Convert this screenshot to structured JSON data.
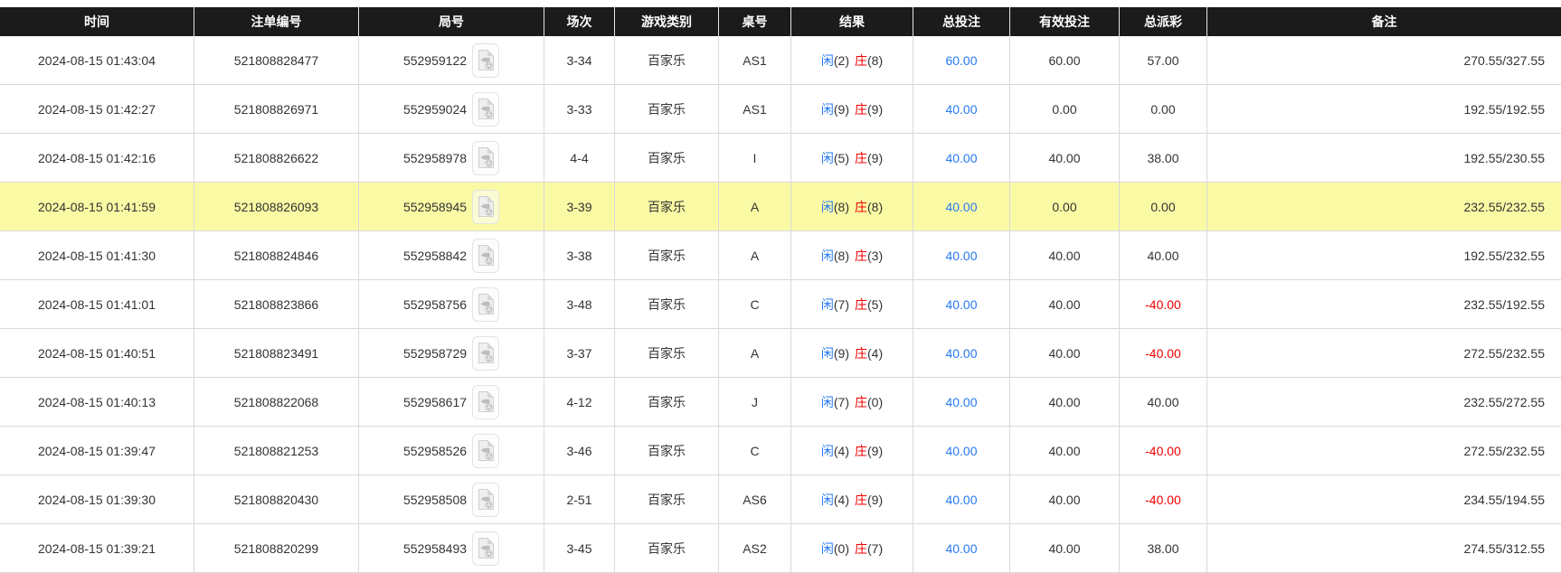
{
  "colors": {
    "header_bg": "#1b1b1b",
    "header_text": "#ffffff",
    "row_border": "#d9d9d9",
    "highlight_bg": "#fafaa5",
    "link_blue": "#2779f2",
    "loss_red": "#f20000",
    "text": "#333333"
  },
  "icons": {
    "video_replay": "video-file-icon"
  },
  "table": {
    "columns": [
      {
        "key": "time",
        "label": "时间"
      },
      {
        "key": "bet_no",
        "label": "注单编号"
      },
      {
        "key": "round_no",
        "label": "局号"
      },
      {
        "key": "session",
        "label": "场次"
      },
      {
        "key": "game_type",
        "label": "游戏类别"
      },
      {
        "key": "table_no",
        "label": "桌号"
      },
      {
        "key": "result",
        "label": "结果"
      },
      {
        "key": "total_bet",
        "label": "总投注"
      },
      {
        "key": "valid_bet",
        "label": "有效投注"
      },
      {
        "key": "total_payout",
        "label": "总派彩"
      },
      {
        "key": "remark",
        "label": "备注"
      }
    ],
    "result_labels": {
      "player": "闲",
      "banker": "庄"
    },
    "rows": [
      {
        "time": "2024-08-15 01:43:04",
        "bet_no": "521808828477",
        "round_no": "552959122",
        "session": "3-34",
        "game_type": "百家乐",
        "table_no": "AS1",
        "result": {
          "player": "(2)",
          "banker": "(8)"
        },
        "total_bet": "60.00",
        "valid_bet": "60.00",
        "total_payout": "57.00",
        "remark": "270.55/327.55",
        "highlighted": false
      },
      {
        "time": "2024-08-15 01:42:27",
        "bet_no": "521808826971",
        "round_no": "552959024",
        "session": "3-33",
        "game_type": "百家乐",
        "table_no": "AS1",
        "result": {
          "player": "(9)",
          "banker": "(9)"
        },
        "total_bet": "40.00",
        "valid_bet": "0.00",
        "total_payout": "0.00",
        "remark": "192.55/192.55",
        "highlighted": false
      },
      {
        "time": "2024-08-15 01:42:16",
        "bet_no": "521808826622",
        "round_no": "552958978",
        "session": "4-4",
        "game_type": "百家乐",
        "table_no": "I",
        "result": {
          "player": "(5)",
          "banker": "(9)"
        },
        "total_bet": "40.00",
        "valid_bet": "40.00",
        "total_payout": "38.00",
        "remark": "192.55/230.55",
        "highlighted": false
      },
      {
        "time": "2024-08-15 01:41:59",
        "bet_no": "521808826093",
        "round_no": "552958945",
        "session": "3-39",
        "game_type": "百家乐",
        "table_no": "A",
        "result": {
          "player": "(8)",
          "banker": "(8)"
        },
        "total_bet": "40.00",
        "valid_bet": "0.00",
        "total_payout": "0.00",
        "remark": "232.55/232.55",
        "highlighted": true
      },
      {
        "time": "2024-08-15 01:41:30",
        "bet_no": "521808824846",
        "round_no": "552958842",
        "session": "3-38",
        "game_type": "百家乐",
        "table_no": "A",
        "result": {
          "player": "(8)",
          "banker": "(3)"
        },
        "total_bet": "40.00",
        "valid_bet": "40.00",
        "total_payout": "40.00",
        "remark": "192.55/232.55",
        "highlighted": false
      },
      {
        "time": "2024-08-15 01:41:01",
        "bet_no": "521808823866",
        "round_no": "552958756",
        "session": "3-48",
        "game_type": "百家乐",
        "table_no": "C",
        "result": {
          "player": "(7)",
          "banker": "(5)"
        },
        "total_bet": "40.00",
        "valid_bet": "40.00",
        "total_payout": "-40.00",
        "remark": "232.55/192.55",
        "highlighted": false
      },
      {
        "time": "2024-08-15 01:40:51",
        "bet_no": "521808823491",
        "round_no": "552958729",
        "session": "3-37",
        "game_type": "百家乐",
        "table_no": "A",
        "result": {
          "player": "(9)",
          "banker": "(4)"
        },
        "total_bet": "40.00",
        "valid_bet": "40.00",
        "total_payout": "-40.00",
        "remark": "272.55/232.55",
        "highlighted": false
      },
      {
        "time": "2024-08-15 01:40:13",
        "bet_no": "521808822068",
        "round_no": "552958617",
        "session": "4-12",
        "game_type": "百家乐",
        "table_no": "J",
        "result": {
          "player": "(7)",
          "banker": "(0)"
        },
        "total_bet": "40.00",
        "valid_bet": "40.00",
        "total_payout": "40.00",
        "remark": "232.55/272.55",
        "highlighted": false
      },
      {
        "time": "2024-08-15 01:39:47",
        "bet_no": "521808821253",
        "round_no": "552958526",
        "session": "3-46",
        "game_type": "百家乐",
        "table_no": "C",
        "result": {
          "player": "(4)",
          "banker": "(9)"
        },
        "total_bet": "40.00",
        "valid_bet": "40.00",
        "total_payout": "-40.00",
        "remark": "272.55/232.55",
        "highlighted": false
      },
      {
        "time": "2024-08-15 01:39:30",
        "bet_no": "521808820430",
        "round_no": "552958508",
        "session": "2-51",
        "game_type": "百家乐",
        "table_no": "AS6",
        "result": {
          "player": "(4)",
          "banker": "(9)"
        },
        "total_bet": "40.00",
        "valid_bet": "40.00",
        "total_payout": "-40.00",
        "remark": "234.55/194.55",
        "highlighted": false
      },
      {
        "time": "2024-08-15 01:39:21",
        "bet_no": "521808820299",
        "round_no": "552958493",
        "session": "3-45",
        "game_type": "百家乐",
        "table_no": "AS2",
        "result": {
          "player": "(0)",
          "banker": "(7)"
        },
        "total_bet": "40.00",
        "valid_bet": "40.00",
        "total_payout": "38.00",
        "remark": "274.55/312.55",
        "highlighted": false
      }
    ]
  }
}
